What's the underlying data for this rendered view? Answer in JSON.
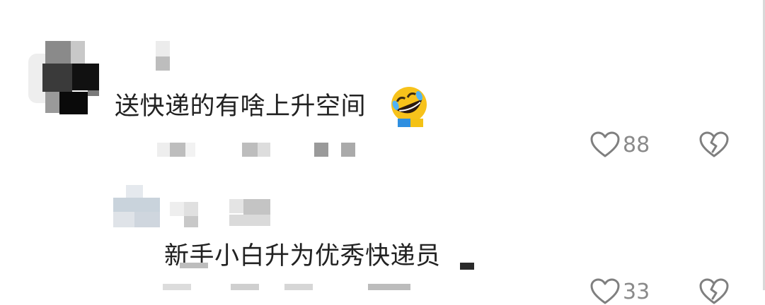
{
  "comments": [
    {
      "text": "送快递的有啥上升空间",
      "emoji": "rofl-emoji",
      "likes": "88",
      "like_icon": "heart-icon",
      "dislike_icon": "broken-heart-icon"
    },
    {
      "text": "新手小白升为优秀快递员",
      "likes": "33",
      "like_icon": "heart-icon",
      "dislike_icon": "broken-heart-icon"
    }
  ],
  "colors": {
    "text": "#222222",
    "count": "#8a8a8a",
    "icon": "#7f7f7f",
    "mosaic_dark": "#111111",
    "mosaic_light": "#cfcfcf"
  }
}
